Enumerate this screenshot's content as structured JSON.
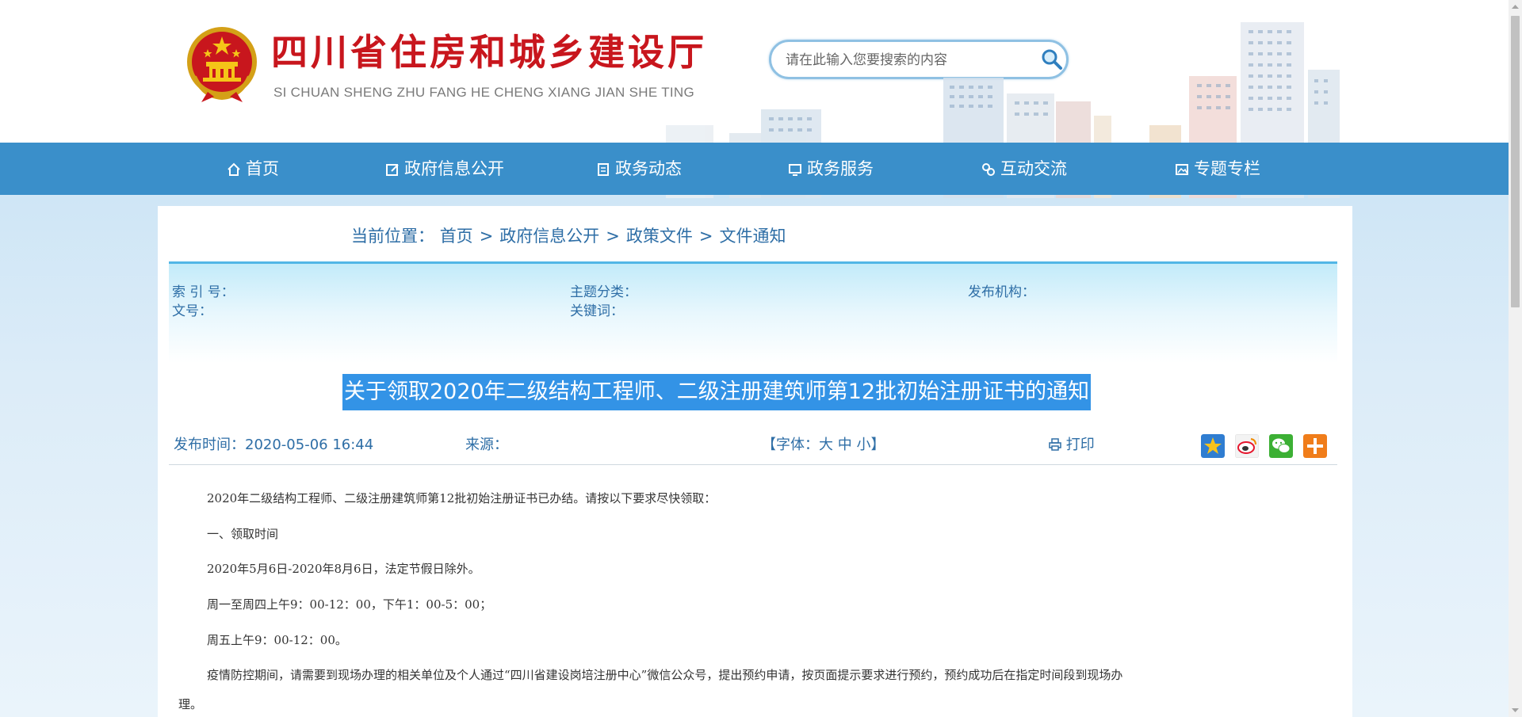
{
  "header": {
    "title": "四川省住房和城乡建设厅",
    "subtitle": "SI CHUAN SHENG ZHU FANG HE CHENG XIANG JIAN SHE TING",
    "search_placeholder": "请在此输入您要搜索的内容",
    "emblem_icon": "national-emblem-icon",
    "search_icon": "magnifier-icon"
  },
  "nav": {
    "items": [
      {
        "label": "首页",
        "icon": "home-icon"
      },
      {
        "label": "政府信息公开",
        "icon": "edit-icon"
      },
      {
        "label": "政务动态",
        "icon": "document-icon"
      },
      {
        "label": "政务服务",
        "icon": "monitor-icon"
      },
      {
        "label": "互动交流",
        "icon": "interact-icon"
      },
      {
        "label": "专题专栏",
        "icon": "image-icon"
      }
    ]
  },
  "breadcrumb": {
    "prefix": "当前位置：",
    "items": [
      "首页",
      "政府信息公开",
      "政策文件",
      "文件通知"
    ],
    "separator": ">"
  },
  "meta": {
    "index_no": "索 引 号：",
    "topic": "主题分类：",
    "publisher": "发布机构：",
    "doc_no": "文号：",
    "keywords": "关键词："
  },
  "article": {
    "title": "关于领取2020年二级结构工程师、二级注册建筑师第12批初始注册证书的通知",
    "publish_time": "发布时间：2020-05-06 16:44",
    "source": "来源：",
    "font_label_prefix": "【字体：",
    "font_sizes": [
      "大",
      "中",
      "小"
    ],
    "font_label_suffix": "】",
    "print_label": "打印",
    "share_icons": [
      "favorite-icon",
      "weibo-icon",
      "wechat-icon",
      "more-share-icon"
    ],
    "paragraphs": [
      "2020年二级结构工程师、二级注册建筑师第12批初始注册证书已办结。请按以下要求尽快领取：",
      "一、领取时间",
      "2020年5月6日-2020年8月6日，法定节假日除外。",
      "周一至周四上午9：00-12：00，下午1：00-5：00；",
      "周五上午9：00-12：00。",
      "疫情防控期间，请需要到现场办理的相关单位及个人通过“四川省建设岗培注册中心”微信公众号，提出预约申请，按页面提示要求进行预约，预约成功后在指定时间段到现场办",
      "理。"
    ]
  },
  "colors": {
    "nav_bg": "#3a8fca",
    "title_red": "#c8161d",
    "link_blue": "#2e6ea6",
    "selection_blue": "#3393e6"
  }
}
